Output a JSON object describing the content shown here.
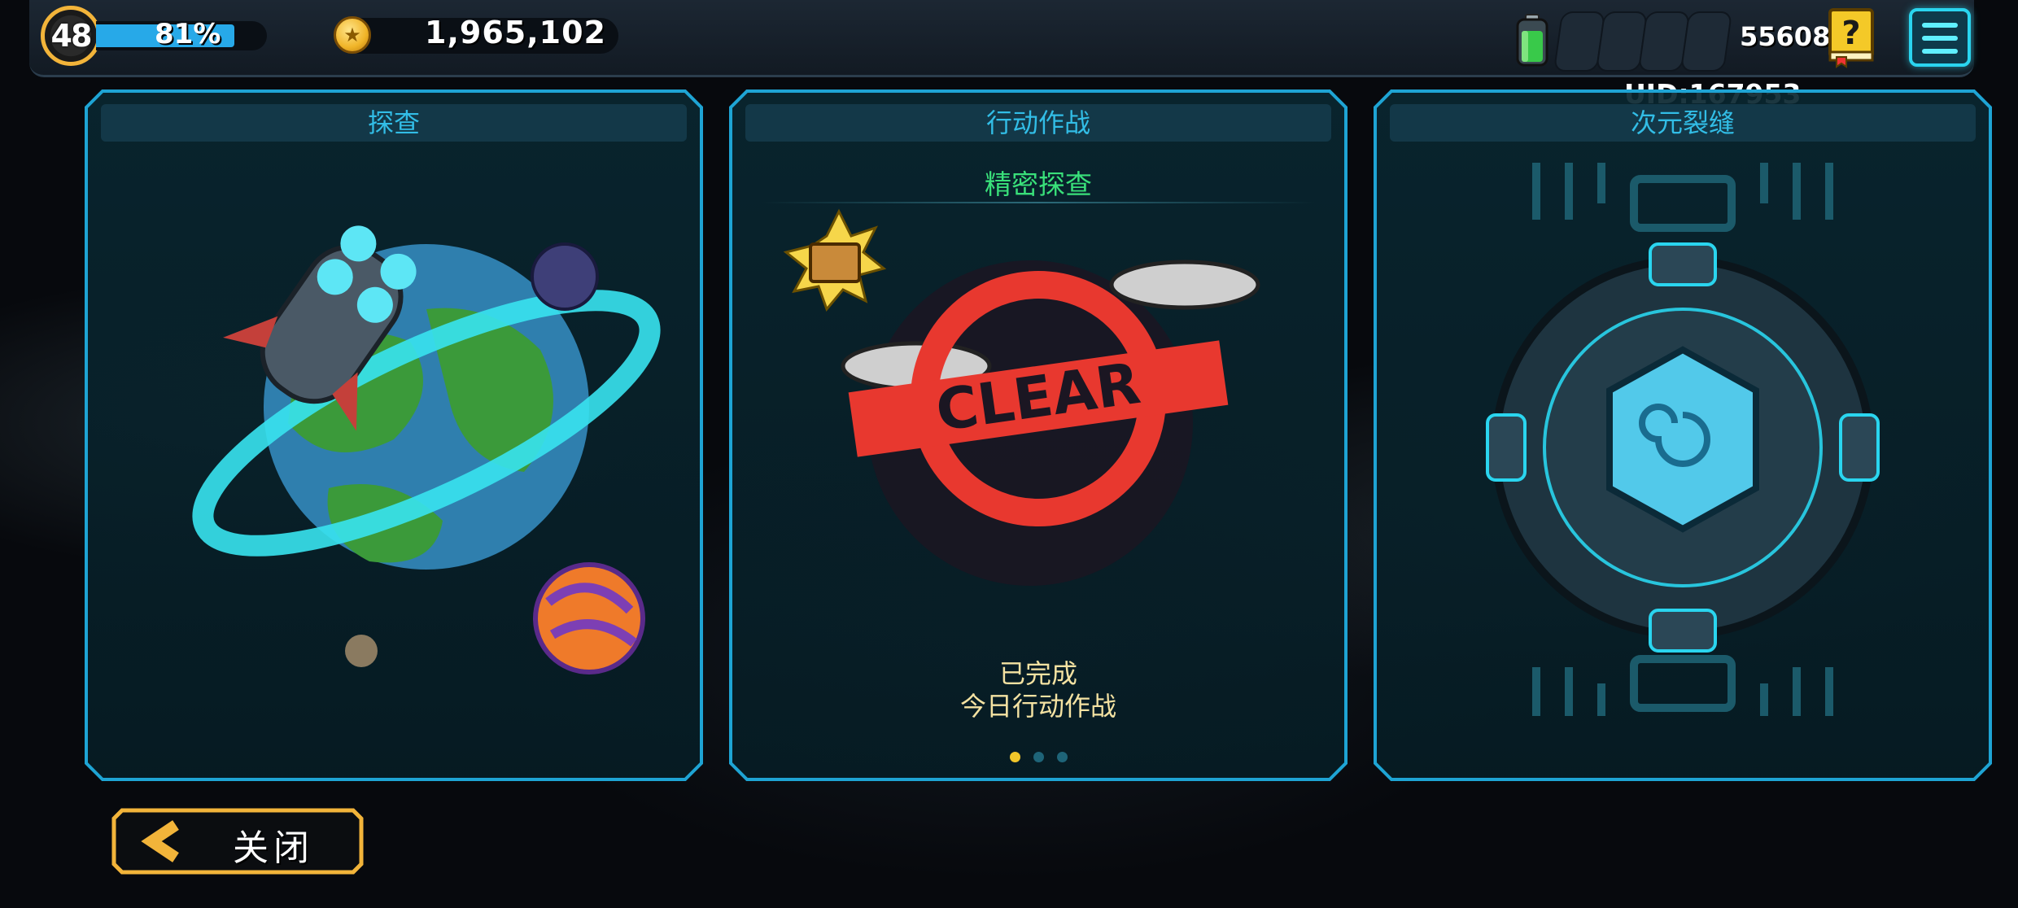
{
  "player": {
    "level": "48",
    "xp_text": "81%",
    "xp_progress": 0.81,
    "gold": "1,965,102",
    "uid_short": "556084",
    "uid_label": "UID:167953"
  },
  "energy_slots": 4,
  "panels": [
    {
      "title": "探查"
    },
    {
      "title": "行动作战",
      "subtitle": "精密探查",
      "stamp": "CLEAR",
      "status_line1": "已完成",
      "status_line2": "今日行动作战",
      "page_dots": 3,
      "active_dot": 0
    },
    {
      "title": "次元裂缝"
    }
  ],
  "close_button": {
    "label": "关闭"
  },
  "colors": {
    "accent_cyan": "#2ad5ef",
    "panel_title": "#32bde6",
    "subtitle_green": "#39e07a",
    "gold_button": "#f2b43a",
    "clear_red": "#e8382f"
  },
  "icons": [
    "level-badge",
    "gold-coin-icon",
    "battery-icon",
    "help-book-icon",
    "menu-icon",
    "chevron-left-icon"
  ]
}
